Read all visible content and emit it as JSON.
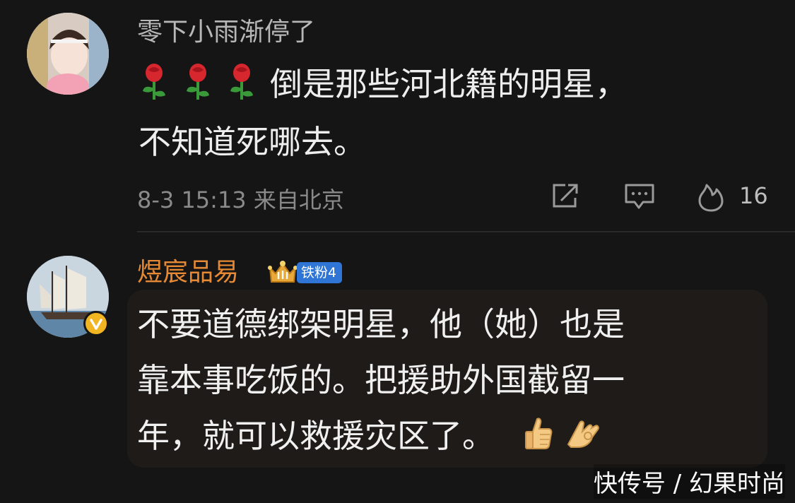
{
  "comments": [
    {
      "username": "零下小雨渐停了",
      "emoji_names": [
        "rose-emoji",
        "rose-emoji",
        "rose-emoji"
      ],
      "text_line1": "倒是那些河北籍的明星，",
      "text_line2": "不知道死哪去。",
      "timestamp": "8-3 15:13 来自北京",
      "likes": "16"
    },
    {
      "username": "煜宸品易",
      "badge_label": "铁粉4",
      "verified": true,
      "text_line1": "不要道德绑架明星，他（她）也是",
      "text_line2": "靠本事吃饭的。把援助外国截留一",
      "text_line3": "年，就可以救援灾区了。",
      "emoji_names": [
        "thumbs-up-emoji",
        "ok-hand-emoji"
      ]
    }
  ],
  "watermark": "快传号 / 幻果时尚",
  "colors": {
    "background": "#151516",
    "username_highlight": "#e58934",
    "badge_blue": "#2f75d6",
    "verified_gold": "#f2b522"
  }
}
